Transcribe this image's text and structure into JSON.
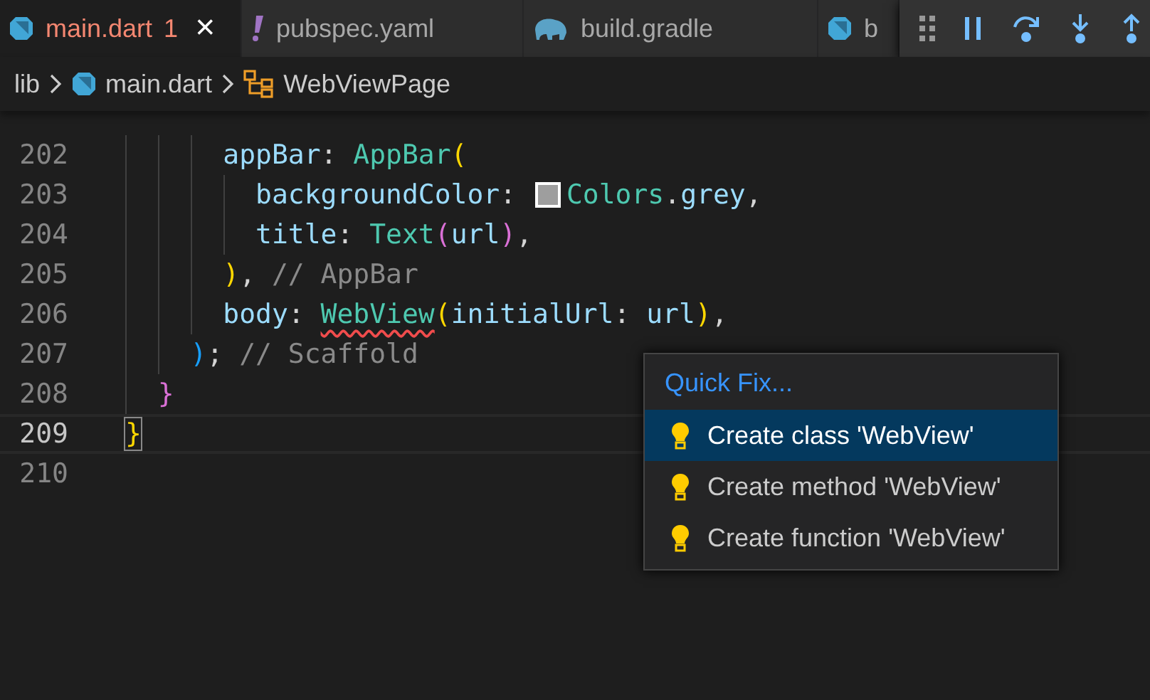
{
  "tabs": [
    {
      "kind": "dart",
      "label": "main.dart",
      "problems": "1",
      "close": "×",
      "selected": true
    },
    {
      "kind": "yaml",
      "label": "pubspec.yaml",
      "selected": false
    },
    {
      "kind": "gradle",
      "label": "build.gradle",
      "selected": false
    },
    {
      "kind": "dart",
      "label": "b",
      "selected": false
    }
  ],
  "breadcrumb": [
    {
      "kind": "folder",
      "label": "lib"
    },
    {
      "kind": "dart-file",
      "label": "main.dart"
    },
    {
      "kind": "class",
      "label": "WebViewPage"
    }
  ],
  "lines": [
    {
      "children": [
        {
          "children": [
            {
              "children": [
                {
                  "number": "202",
                  "current": false,
                  "tokens": [
                    {
                      "kind": "prop",
                      "text": "appBar"
                    },
                    {
                      "kind": "plain",
                      "text": ": "
                    },
                    {
                      "kind": "type",
                      "text": "AppBar"
                    },
                    {
                      "kind": "bracket1",
                      "text": "("
                    }
                  ],
                  "children": [
                    {
                      "number": "203",
                      "current": false,
                      "tokens": [
                        {
                          "kind": "prop",
                          "text": "backgroundColor"
                        },
                        {
                          "kind": "plain",
                          "text": ": "
                        },
                        {
                          "kind": "swatch",
                          "color": "#9e9e9e"
                        },
                        {
                          "kind": "type",
                          "text": "Colors"
                        },
                        {
                          "kind": "plain",
                          "text": "."
                        },
                        {
                          "kind": "prop",
                          "text": "grey"
                        },
                        {
                          "kind": "plain",
                          "text": ","
                        }
                      ]
                    },
                    {
                      "number": "204",
                      "current": false,
                      "tokens": [
                        {
                          "kind": "prop",
                          "text": "title"
                        },
                        {
                          "kind": "plain",
                          "text": ": "
                        },
                        {
                          "kind": "type",
                          "text": "Text"
                        },
                        {
                          "kind": "bracket2",
                          "text": "("
                        },
                        {
                          "kind": "prop",
                          "text": "url"
                        },
                        {
                          "kind": "bracket2",
                          "text": ")"
                        },
                        {
                          "kind": "plain",
                          "text": ","
                        }
                      ]
                    }
                  ]
                },
                {
                  "number": "205",
                  "current": false,
                  "tokens": [
                    {
                      "kind": "bracket1",
                      "text": ")"
                    },
                    {
                      "kind": "plain",
                      "text": ", "
                    },
                    {
                      "kind": "comment",
                      "text": "// AppBar"
                    }
                  ]
                },
                {
                  "number": "206",
                  "current": false,
                  "tokens": [
                    {
                      "kind": "prop",
                      "text": "body"
                    },
                    {
                      "kind": "plain",
                      "text": ": "
                    },
                    {
                      "kind": "error",
                      "text": "WebView"
                    },
                    {
                      "kind": "bracket1",
                      "text": "("
                    },
                    {
                      "kind": "prop",
                      "text": "initialUrl"
                    },
                    {
                      "kind": "plain",
                      "text": ": "
                    },
                    {
                      "kind": "prop",
                      "text": "url"
                    },
                    {
                      "kind": "bracket1",
                      "text": ")"
                    },
                    {
                      "kind": "plain",
                      "text": ","
                    }
                  ]
                }
              ]
            },
            {
              "number": "207",
              "current": false,
              "tokens": [
                {
                  "kind": "bracket3",
                  "text": ")"
                },
                {
                  "kind": "plain",
                  "text": "; "
                },
                {
                  "kind": "comment",
                  "text": "// Scaffold"
                }
              ]
            }
          ]
        },
        {
          "number": "208",
          "current": false,
          "tokens": [
            {
              "kind": "bracket2",
              "text": "}"
            }
          ]
        }
      ]
    },
    {
      "number": "209",
      "current": true,
      "tokens": [
        {
          "kind": "match",
          "text": "}"
        }
      ]
    },
    {
      "number": "210",
      "current": false
    }
  ],
  "quick_fix": {
    "title": "Quick Fix...",
    "items": [
      {
        "label": "Create class 'WebView'",
        "selected": true
      },
      {
        "label": "Create method 'WebView'",
        "selected": false
      },
      {
        "label": "Create function 'WebView'",
        "selected": false
      }
    ]
  }
}
